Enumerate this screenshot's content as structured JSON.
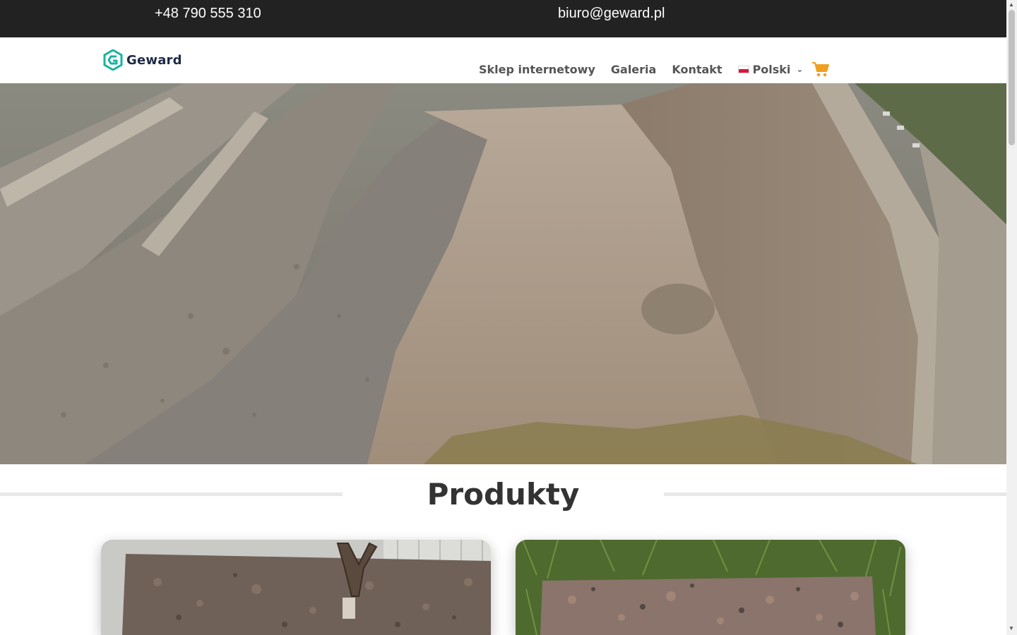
{
  "topbar": {
    "phone": "+48 790 555 310",
    "email": "biuro@geward.pl"
  },
  "header": {
    "logo_text": "Geward",
    "nav": [
      {
        "label": "Sklep internetowy"
      },
      {
        "label": "Galeria"
      },
      {
        "label": "Kontakt"
      }
    ],
    "language": {
      "label": "Polski",
      "flag": "poland-flag-icon"
    },
    "cart_icon": "shopping-cart-icon"
  },
  "section": {
    "title": "Produkty"
  },
  "colors": {
    "topbar_bg": "#222222",
    "nav_text": "#555555",
    "cart_accent": "#f0a020",
    "logo_mark": "#19b3a0",
    "title_text": "#333333"
  }
}
